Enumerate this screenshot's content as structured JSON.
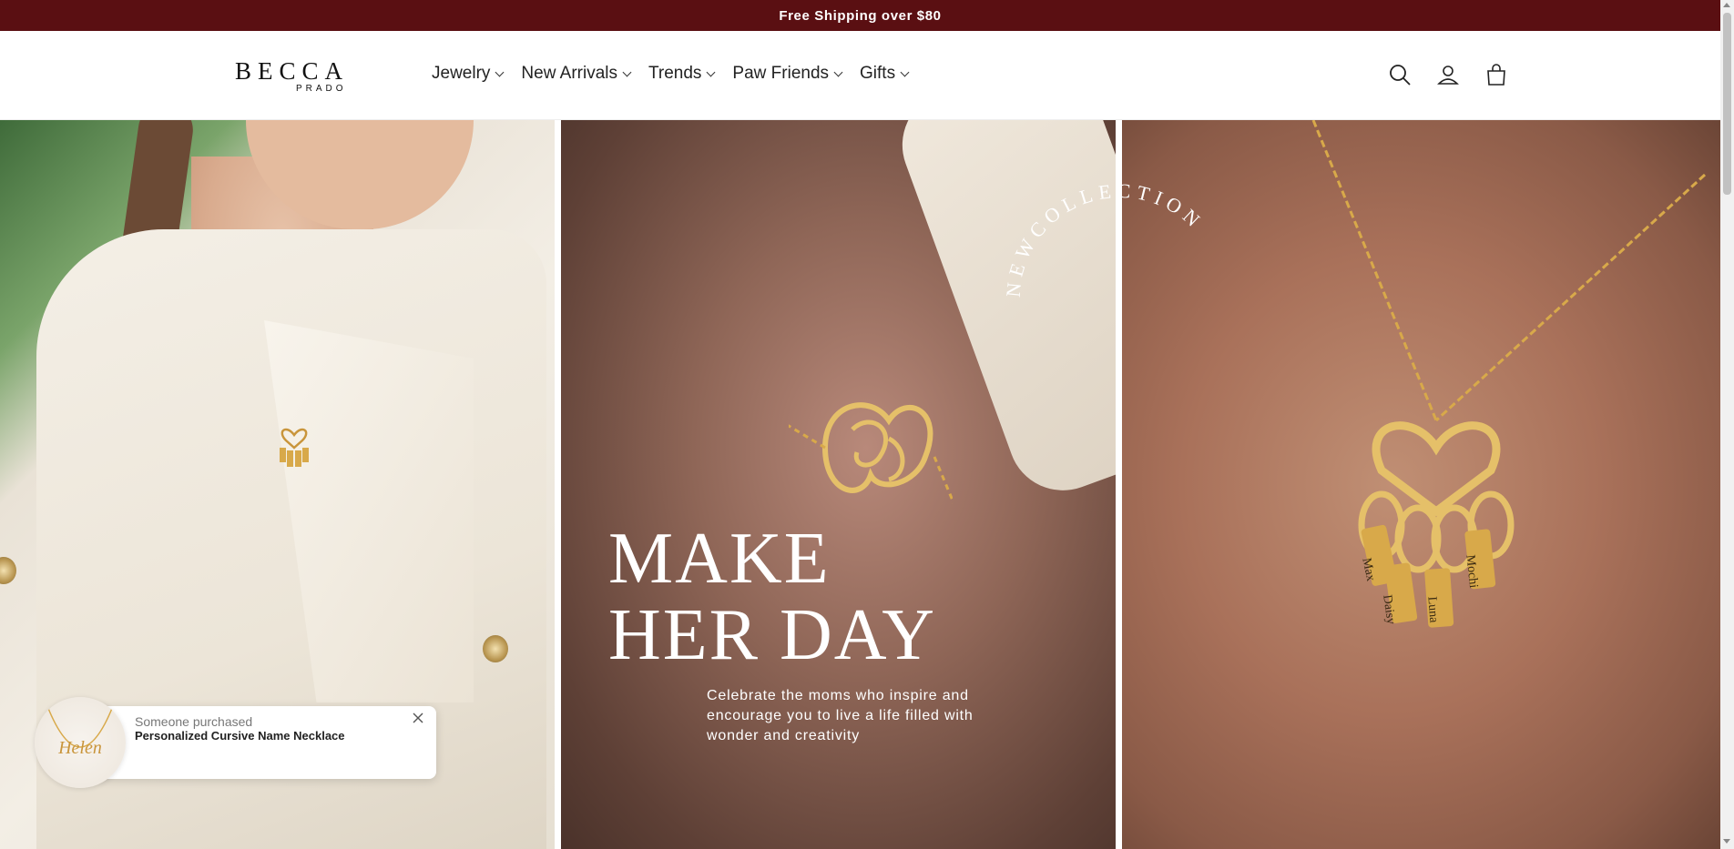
{
  "announcement": {
    "text": "Free Shipping over $80"
  },
  "header": {
    "logo": {
      "line1": "BECCA",
      "line2": "PRADO"
    },
    "nav": [
      {
        "label": "Jewelry"
      },
      {
        "label": "New Arrivals"
      },
      {
        "label": "Trends"
      },
      {
        "label": "Paw Friends"
      },
      {
        "label": "Gifts"
      }
    ],
    "icons": [
      "search-icon",
      "account-icon",
      "cart-icon"
    ]
  },
  "hero": {
    "title_line1": "MAKE",
    "title_line2": "HER DAY",
    "subtitle": "Celebrate the moms who inspire and encourage you to live a life filled with wonder and creativity",
    "badge_text": "NEWCOLLECTION",
    "pendant_names": [
      "Max",
      "Daisy",
      "Luna",
      "Mochi"
    ]
  },
  "popup": {
    "line1": "Someone purchased",
    "line2": "Personalized Cursive Name Necklace",
    "image_text": "Helen"
  },
  "colors": {
    "announcement_bg": "#5a0f12",
    "gold": "#d8a94a"
  }
}
